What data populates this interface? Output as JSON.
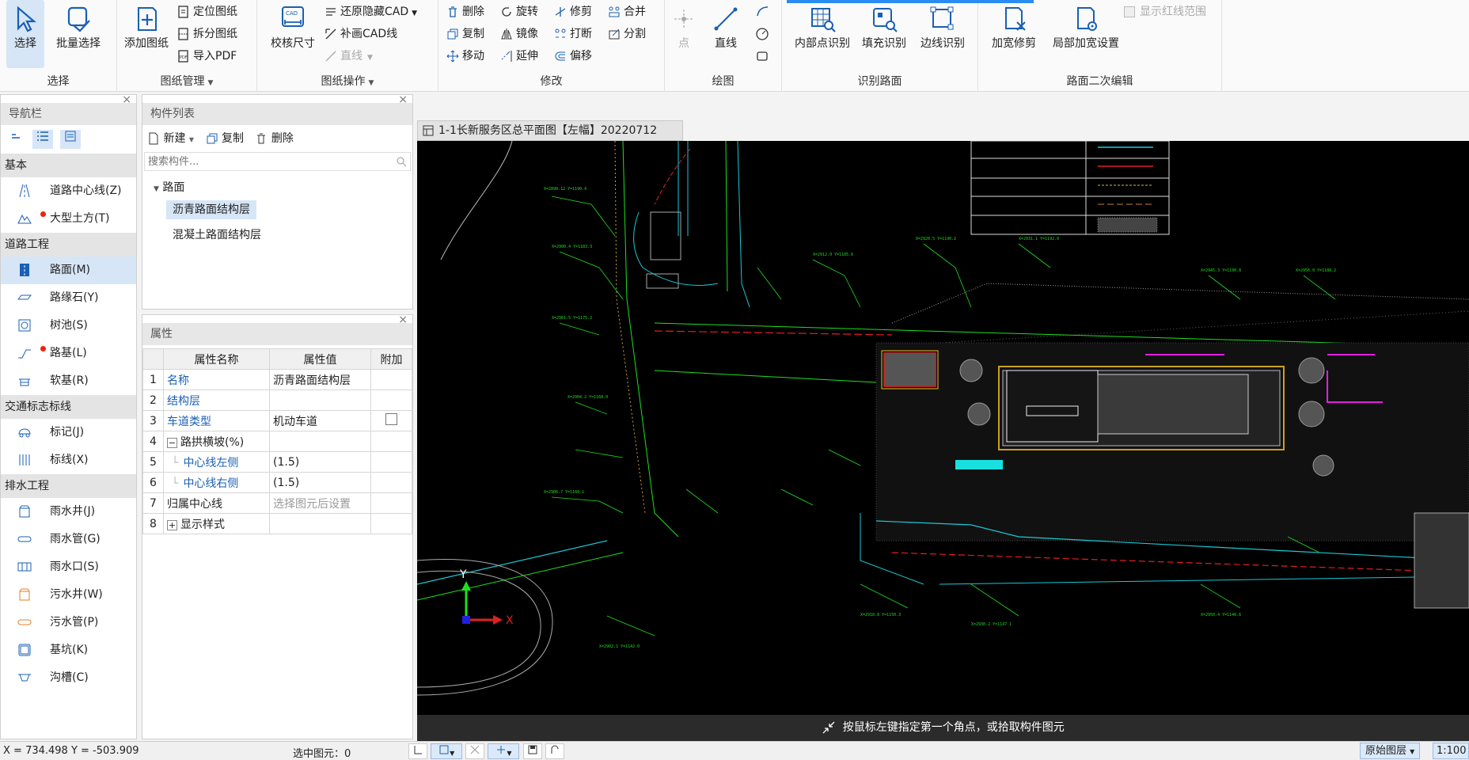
{
  "ribbon": {
    "groups": {
      "select": "选择",
      "drawing_mgmt": "图纸管理",
      "drawing_ops": "图纸操作",
      "modify": "修改",
      "draw": "绘图",
      "identify_road": "识别路面",
      "road_edit2": "路面二次编辑"
    },
    "select_btn": "选择",
    "batch_select_btn": "批量选择",
    "add_drawing_btn": "添加图纸",
    "locate_drawing": "定位图纸",
    "split_drawing": "拆分图纸",
    "import_pdf": "导入PDF",
    "calibrate_size": "校核尺寸",
    "restore_hidden_cad": "还原隐藏CAD",
    "supplement_cad": "补画CAD线",
    "line_disabled": "直线",
    "delete": "删除",
    "rotate": "旋转",
    "trim": "修剪",
    "merge": "合并",
    "copy": "复制",
    "mirror": "镜像",
    "break": "打断",
    "divide": "分割",
    "move": "移动",
    "extend": "延伸",
    "offset": "偏移",
    "point": "点",
    "line": "直线",
    "inner_point_identify": "内部点识别",
    "fill_identify": "填充识别",
    "edge_identify": "边线识别",
    "widen_repair": "加宽修剪",
    "local_widen": "局部加宽设置",
    "show_redline": "显示红线范围"
  },
  "nav": {
    "title": "导航栏",
    "sections": [
      {
        "label": "基本",
        "items": [
          {
            "label": "道路中心线(Z)",
            "icon": "road-centerline-icon",
            "dot": false
          },
          {
            "label": "大型土方(T)",
            "icon": "earthwork-icon",
            "dot": true
          }
        ]
      },
      {
        "label": "道路工程",
        "items": [
          {
            "label": "路面(M)",
            "icon": "pavement-icon",
            "dot": false,
            "selected": true
          },
          {
            "label": "路缘石(Y)",
            "icon": "curb-icon",
            "dot": false
          },
          {
            "label": "树池(S)",
            "icon": "tree-pit-icon",
            "dot": false
          },
          {
            "label": "路基(L)",
            "icon": "subgrade-icon",
            "dot": true
          },
          {
            "label": "软基(R)",
            "icon": "soft-foundation-icon",
            "dot": false
          }
        ]
      },
      {
        "label": "交通标志标线",
        "items": [
          {
            "label": "标记(J)",
            "icon": "marking-icon",
            "dot": false
          },
          {
            "label": "标线(X)",
            "icon": "line-marking-icon",
            "dot": false
          }
        ]
      },
      {
        "label": "排水工程",
        "items": [
          {
            "label": "雨水井(J)",
            "icon": "rain-well-icon",
            "dot": false
          },
          {
            "label": "雨水管(G)",
            "icon": "rain-pipe-icon",
            "dot": false
          },
          {
            "label": "雨水口(S)",
            "icon": "rain-inlet-icon",
            "dot": false
          },
          {
            "label": "污水井(W)",
            "icon": "sewage-well-icon",
            "dot": false
          },
          {
            "label": "污水管(P)",
            "icon": "sewage-pipe-icon",
            "dot": false
          },
          {
            "label": "基坑(K)",
            "icon": "foundation-pit-icon",
            "dot": false
          },
          {
            "label": "沟槽(C)",
            "icon": "trench-icon",
            "dot": false
          }
        ]
      }
    ]
  },
  "components": {
    "title": "构件列表",
    "new_btn": "新建",
    "copy_btn": "复制",
    "delete_btn": "删除",
    "search_placeholder": "搜索构件...",
    "tree_root": "路面",
    "items": [
      "沥青路面结构层",
      "混凝土路面结构层"
    ]
  },
  "properties": {
    "title": "属性",
    "headers": [
      "属性名称",
      "属性值",
      "附加"
    ],
    "rows": [
      {
        "num": "1",
        "name": "名称",
        "value": "沥青路面结构层"
      },
      {
        "num": "2",
        "name": "结构层",
        "value": ""
      },
      {
        "num": "3",
        "name": "车道类型",
        "value": "机动车道"
      },
      {
        "num": "4",
        "name": "路拱横坡(%)",
        "value": ""
      },
      {
        "num": "5",
        "name": "中心线左侧",
        "value": "(1.5)"
      },
      {
        "num": "6",
        "name": "中心线右侧",
        "value": "(1.5)"
      },
      {
        "num": "7",
        "name": "归属中心线",
        "value": "选择图元后设置"
      },
      {
        "num": "8",
        "name": "显示样式",
        "value": ""
      }
    ]
  },
  "drawing_tab": "1-1长新服务区总平面图【左幅】20220712",
  "hint": "按鼠标左键指定第一个角点，或拾取构件图元",
  "status": {
    "coords": "X = 734.498 Y = -503.909",
    "selected": "选中图元：0",
    "layer": "原始图层",
    "scale": "1:100"
  },
  "axis": {
    "x": "X",
    "y": "Y"
  },
  "colors": {
    "accent": "#1a5fb4",
    "selected_bg": "#d6e6f7",
    "canvas": "#000000",
    "cad_green": "#1ee01e",
    "cad_cyan": "#19c9d6",
    "cad_red": "#e02020"
  }
}
